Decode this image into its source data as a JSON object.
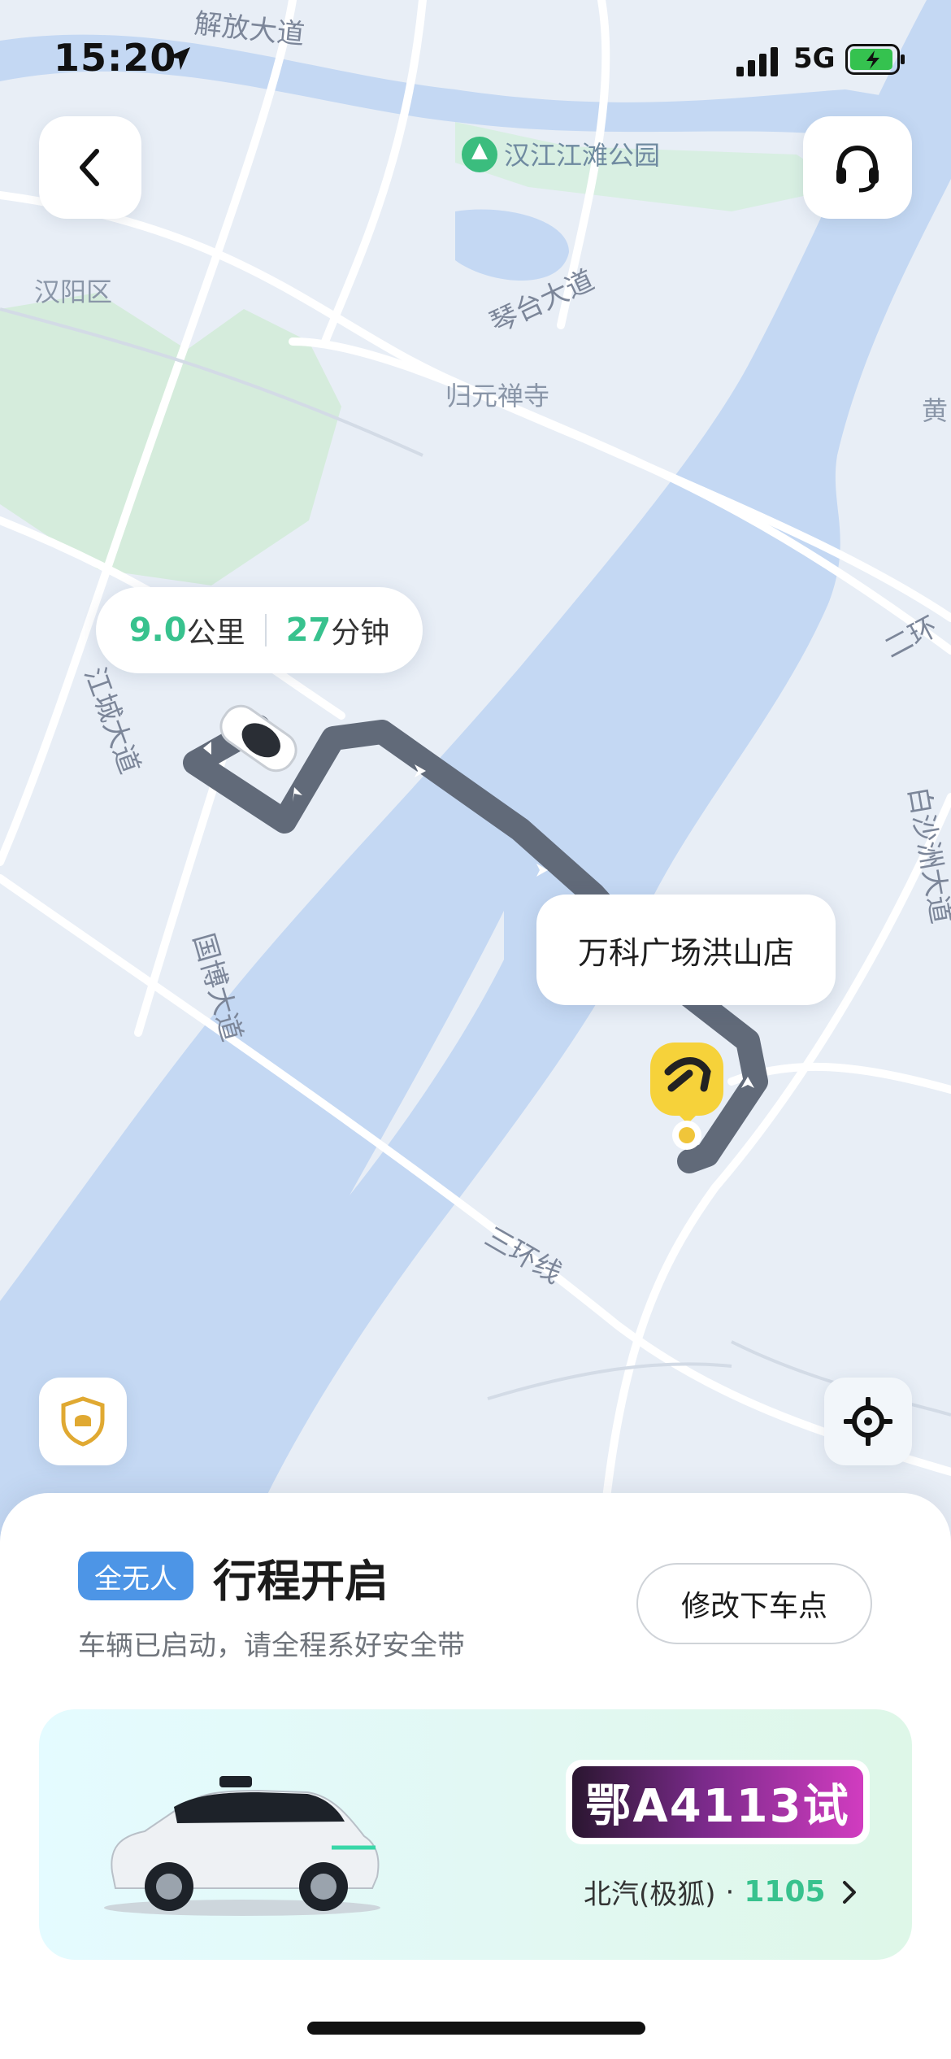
{
  "status_bar": {
    "time": "15:20",
    "network": "5G"
  },
  "map": {
    "labels": {
      "road_top": "解放大道",
      "park": "汉江江滩公园",
      "district": "汉阳区",
      "qintai": "琴台大道",
      "temple": "归元禅寺",
      "huang": "黄",
      "ring2": "二环",
      "jiangcheng": "江城大道",
      "guobo": "国博大道",
      "baishazhou": "白沙洲大道",
      "ring3": "三环线"
    },
    "route_info": {
      "distance_value": "9.0",
      "distance_unit": "公里",
      "time_value": "27",
      "time_unit": "分钟"
    },
    "destination": "万科广场洪山店"
  },
  "icons": {
    "back": "chevron-left-icon",
    "support": "headset-icon",
    "safety": "shield-icon",
    "locate": "crosshair-icon"
  },
  "trip": {
    "badge": "全无人",
    "title": "行程开启",
    "subtitle": "车辆已启动，请全程系好安全带",
    "modify_label": "修改下车点"
  },
  "vehicle": {
    "plate": "鄂A4113试",
    "model": "北汽(极狐)",
    "separator": "·",
    "number": "1105"
  },
  "colors": {
    "accent_green": "#38c28e",
    "badge_blue": "#4d95e6",
    "river": "#c4d8f3"
  }
}
